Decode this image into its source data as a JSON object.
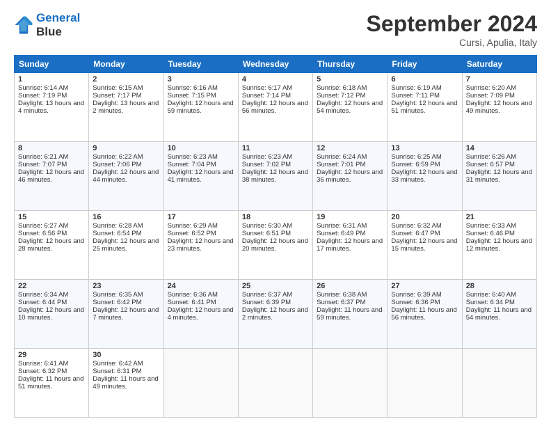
{
  "header": {
    "logo_line1": "General",
    "logo_line2": "Blue",
    "month_title": "September 2024",
    "subtitle": "Cursi, Apulia, Italy"
  },
  "days_of_week": [
    "Sunday",
    "Monday",
    "Tuesday",
    "Wednesday",
    "Thursday",
    "Friday",
    "Saturday"
  ],
  "weeks": [
    [
      {
        "day": "1",
        "sunrise": "6:14 AM",
        "sunset": "7:19 PM",
        "daylight": "13 hours and 4 minutes."
      },
      {
        "day": "2",
        "sunrise": "6:15 AM",
        "sunset": "7:17 PM",
        "daylight": "13 hours and 2 minutes."
      },
      {
        "day": "3",
        "sunrise": "6:16 AM",
        "sunset": "7:15 PM",
        "daylight": "12 hours and 59 minutes."
      },
      {
        "day": "4",
        "sunrise": "6:17 AM",
        "sunset": "7:14 PM",
        "daylight": "12 hours and 56 minutes."
      },
      {
        "day": "5",
        "sunrise": "6:18 AM",
        "sunset": "7:12 PM",
        "daylight": "12 hours and 54 minutes."
      },
      {
        "day": "6",
        "sunrise": "6:19 AM",
        "sunset": "7:11 PM",
        "daylight": "12 hours and 51 minutes."
      },
      {
        "day": "7",
        "sunrise": "6:20 AM",
        "sunset": "7:09 PM",
        "daylight": "12 hours and 49 minutes."
      }
    ],
    [
      {
        "day": "8",
        "sunrise": "6:21 AM",
        "sunset": "7:07 PM",
        "daylight": "12 hours and 46 minutes."
      },
      {
        "day": "9",
        "sunrise": "6:22 AM",
        "sunset": "7:06 PM",
        "daylight": "12 hours and 44 minutes."
      },
      {
        "day": "10",
        "sunrise": "6:23 AM",
        "sunset": "7:04 PM",
        "daylight": "12 hours and 41 minutes."
      },
      {
        "day": "11",
        "sunrise": "6:23 AM",
        "sunset": "7:02 PM",
        "daylight": "12 hours and 38 minutes."
      },
      {
        "day": "12",
        "sunrise": "6:24 AM",
        "sunset": "7:01 PM",
        "daylight": "12 hours and 36 minutes."
      },
      {
        "day": "13",
        "sunrise": "6:25 AM",
        "sunset": "6:59 PM",
        "daylight": "12 hours and 33 minutes."
      },
      {
        "day": "14",
        "sunrise": "6:26 AM",
        "sunset": "6:57 PM",
        "daylight": "12 hours and 31 minutes."
      }
    ],
    [
      {
        "day": "15",
        "sunrise": "6:27 AM",
        "sunset": "6:56 PM",
        "daylight": "12 hours and 28 minutes."
      },
      {
        "day": "16",
        "sunrise": "6:28 AM",
        "sunset": "6:54 PM",
        "daylight": "12 hours and 25 minutes."
      },
      {
        "day": "17",
        "sunrise": "6:29 AM",
        "sunset": "6:52 PM",
        "daylight": "12 hours and 23 minutes."
      },
      {
        "day": "18",
        "sunrise": "6:30 AM",
        "sunset": "6:51 PM",
        "daylight": "12 hours and 20 minutes."
      },
      {
        "day": "19",
        "sunrise": "6:31 AM",
        "sunset": "6:49 PM",
        "daylight": "12 hours and 17 minutes."
      },
      {
        "day": "20",
        "sunrise": "6:32 AM",
        "sunset": "6:47 PM",
        "daylight": "12 hours and 15 minutes."
      },
      {
        "day": "21",
        "sunrise": "6:33 AM",
        "sunset": "6:46 PM",
        "daylight": "12 hours and 12 minutes."
      }
    ],
    [
      {
        "day": "22",
        "sunrise": "6:34 AM",
        "sunset": "6:44 PM",
        "daylight": "12 hours and 10 minutes."
      },
      {
        "day": "23",
        "sunrise": "6:35 AM",
        "sunset": "6:42 PM",
        "daylight": "12 hours and 7 minutes."
      },
      {
        "day": "24",
        "sunrise": "6:36 AM",
        "sunset": "6:41 PM",
        "daylight": "12 hours and 4 minutes."
      },
      {
        "day": "25",
        "sunrise": "6:37 AM",
        "sunset": "6:39 PM",
        "daylight": "12 hours and 2 minutes."
      },
      {
        "day": "26",
        "sunrise": "6:38 AM",
        "sunset": "6:37 PM",
        "daylight": "11 hours and 59 minutes."
      },
      {
        "day": "27",
        "sunrise": "6:39 AM",
        "sunset": "6:36 PM",
        "daylight": "11 hours and 56 minutes."
      },
      {
        "day": "28",
        "sunrise": "6:40 AM",
        "sunset": "6:34 PM",
        "daylight": "11 hours and 54 minutes."
      }
    ],
    [
      {
        "day": "29",
        "sunrise": "6:41 AM",
        "sunset": "6:32 PM",
        "daylight": "11 hours and 51 minutes."
      },
      {
        "day": "30",
        "sunrise": "6:42 AM",
        "sunset": "6:31 PM",
        "daylight": "11 hours and 49 minutes."
      },
      null,
      null,
      null,
      null,
      null
    ]
  ],
  "labels": {
    "sunrise": "Sunrise:",
    "sunset": "Sunset:",
    "daylight": "Daylight:"
  }
}
